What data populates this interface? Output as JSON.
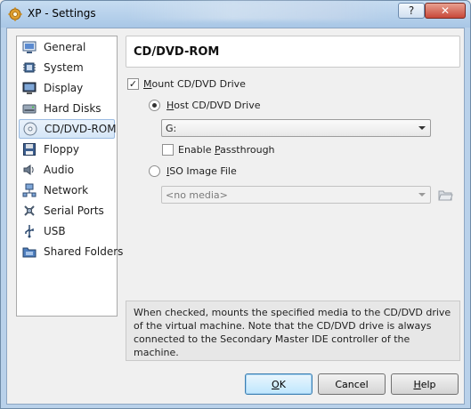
{
  "window": {
    "title": "XP - Settings",
    "help_label": "?",
    "close_label": "✕"
  },
  "sidebar": {
    "items": [
      {
        "label": "General",
        "icon": "general-icon"
      },
      {
        "label": "System",
        "icon": "system-chip-icon"
      },
      {
        "label": "Display",
        "icon": "monitor-icon"
      },
      {
        "label": "Hard Disks",
        "icon": "hard-disk-icon"
      },
      {
        "label": "CD/DVD-ROM",
        "icon": "cd-dvd-icon",
        "selected": true
      },
      {
        "label": "Floppy",
        "icon": "floppy-icon"
      },
      {
        "label": "Audio",
        "icon": "speaker-icon"
      },
      {
        "label": "Network",
        "icon": "network-icon"
      },
      {
        "label": "Serial Ports",
        "icon": "serial-port-icon"
      },
      {
        "label": "USB",
        "icon": "usb-icon"
      },
      {
        "label": "Shared Folders",
        "icon": "shared-folder-icon"
      }
    ]
  },
  "page": {
    "title": "CD/DVD-ROM",
    "mount": {
      "pre": "",
      "mnemonic": "M",
      "post": "ount CD/DVD Drive",
      "checked": true
    },
    "host_drive": {
      "pre": "",
      "mnemonic": "H",
      "post": "ost CD/DVD Drive",
      "selected": true
    },
    "host_drive_value": "G:",
    "passthrough": {
      "pre": "Enable ",
      "mnemonic": "P",
      "post": "assthrough",
      "checked": false
    },
    "iso": {
      "pre": "",
      "mnemonic": "I",
      "post": "SO Image File",
      "selected": false
    },
    "iso_value": "<no media>",
    "info": "When checked, mounts the specified media to the CD/DVD drive of the virtual machine. Note that the CD/DVD drive is always connected to the Secondary Master IDE controller of the machine."
  },
  "buttons": {
    "ok": {
      "mnemonic": "O",
      "post": "K"
    },
    "cancel": "Cancel",
    "help": {
      "mnemonic": "H",
      "post": "elp"
    }
  }
}
